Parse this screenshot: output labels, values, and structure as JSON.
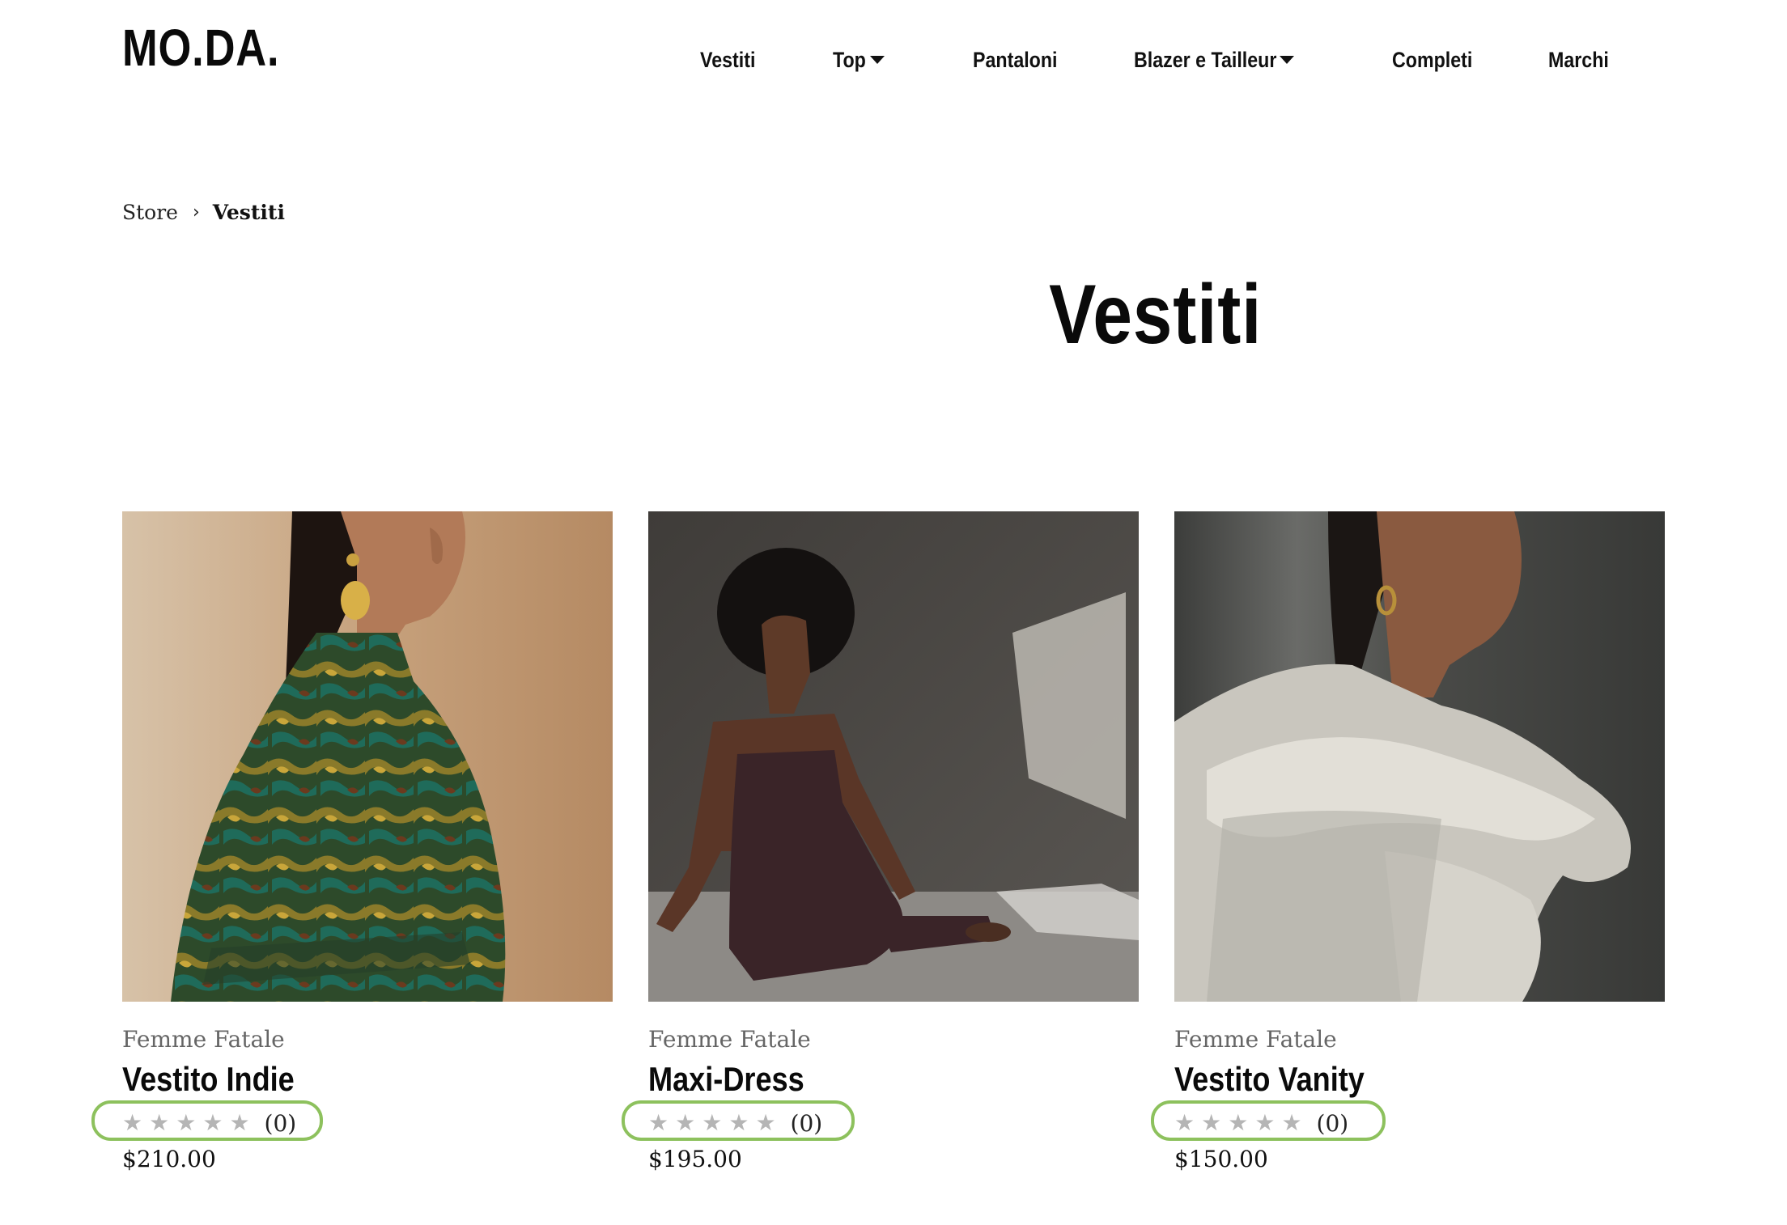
{
  "header": {
    "logo": "MO.DA.",
    "nav": [
      {
        "label": "Vestiti",
        "has_dropdown": false
      },
      {
        "label": "Top",
        "has_dropdown": true
      },
      {
        "label": "Pantaloni",
        "has_dropdown": false
      },
      {
        "label": "Blazer e Tailleur",
        "has_dropdown": true
      },
      {
        "label": "Completi",
        "has_dropdown": false
      },
      {
        "label": "Marchi",
        "has_dropdown": false
      }
    ]
  },
  "breadcrumb": {
    "items": [
      "Store",
      "Vestiti"
    ],
    "separator_icon": "chevron-right-icon"
  },
  "page_title": "Vestiti",
  "products": [
    {
      "brand": "Femme Fatale",
      "name": "Vestito Indie",
      "rating_stars": 0,
      "rating_count": "(0)",
      "price": "$210.00",
      "image": "woman in green patterned long-sleeve dress, profile view"
    },
    {
      "brand": "Femme Fatale",
      "name": "Maxi-Dress",
      "rating_stars": 0,
      "rating_count": "(0)",
      "price": "$195.00",
      "image": "woman seated on floor in dark strapless maxi dress"
    },
    {
      "brand": "Femme Fatale",
      "name": "Vestito Vanity",
      "rating_stars": 0,
      "rating_count": "(0)",
      "price": "$150.00",
      "image": "woman in white sculptural ruffled dress, profile view"
    }
  ],
  "colors": {
    "highlight_ring": "#8dc15d",
    "star_empty": "#b5b5b5",
    "brand_text": "#666666"
  }
}
